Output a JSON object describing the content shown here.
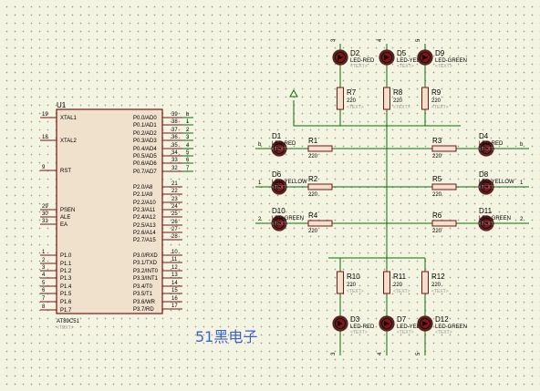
{
  "watermark": "51黑电子",
  "mcu": {
    "ref": "U1",
    "part": "AT89C51",
    "text": "<TEXT>",
    "left_pins": [
      {
        "num": "19",
        "name": "XTAL1"
      },
      {
        "num": "18",
        "name": "XTAL2"
      },
      {
        "num": "9",
        "name": "RST"
      },
      {
        "num": "29",
        "name": "PSEN"
      },
      {
        "num": "30",
        "name": "ALE"
      },
      {
        "num": "31",
        "name": "EA"
      },
      {
        "num": "1",
        "name": "P1.0"
      },
      {
        "num": "2",
        "name": "P1.1"
      },
      {
        "num": "3",
        "name": "P1.2"
      },
      {
        "num": "4",
        "name": "P1.3"
      },
      {
        "num": "5",
        "name": "P1.4"
      },
      {
        "num": "6",
        "name": "P1.5"
      },
      {
        "num": "7",
        "name": "P1.6"
      },
      {
        "num": "8",
        "name": "P1.7"
      }
    ],
    "right_pins": [
      {
        "num": "39",
        "name": "P0.0/AD0",
        "net": "b"
      },
      {
        "num": "38",
        "name": "P0.1/AD1",
        "net": "1"
      },
      {
        "num": "37",
        "name": "P0.2/AD2",
        "net": "2"
      },
      {
        "num": "36",
        "name": "P0.3/AD3",
        "net": "3"
      },
      {
        "num": "35",
        "name": "P0.4/AD4",
        "net": "4"
      },
      {
        "num": "34",
        "name": "P0.5/AD5",
        "net": "5"
      },
      {
        "num": "33",
        "name": "P0.6/AD6",
        "net": "6"
      },
      {
        "num": "32",
        "name": "P0.7/AD7",
        "net": "7"
      },
      {
        "num": "21",
        "name": "P2.0/A8",
        "net": ""
      },
      {
        "num": "22",
        "name": "P2.1/A9",
        "net": ""
      },
      {
        "num": "23",
        "name": "P2.2/A10",
        "net": ""
      },
      {
        "num": "24",
        "name": "P2.3/A11",
        "net": ""
      },
      {
        "num": "25",
        "name": "P2.4/A12",
        "net": ""
      },
      {
        "num": "26",
        "name": "P2.5/A13",
        "net": ""
      },
      {
        "num": "27",
        "name": "P2.6/A14",
        "net": ""
      },
      {
        "num": "28",
        "name": "P2.7/A15",
        "net": ""
      },
      {
        "num": "10",
        "name": "P3.0/RXD",
        "net": ""
      },
      {
        "num": "11",
        "name": "P3.1/TXD",
        "net": ""
      },
      {
        "num": "12",
        "name": "P3.2/INT0",
        "net": ""
      },
      {
        "num": "13",
        "name": "P3.3/INT1",
        "net": ""
      },
      {
        "num": "14",
        "name": "P3.4/T0",
        "net": ""
      },
      {
        "num": "15",
        "name": "P3.5/T1",
        "net": ""
      },
      {
        "num": "16",
        "name": "P3.6/WR",
        "net": ""
      },
      {
        "num": "17",
        "name": "P3.7/RD",
        "net": ""
      }
    ]
  },
  "leds": [
    {
      "id": "D1",
      "part": "LED-RED",
      "net": "b",
      "side": "left"
    },
    {
      "id": "D6",
      "part": "LED-YELLOW",
      "net": "1",
      "side": "left"
    },
    {
      "id": "D10",
      "part": "LED-GREEN",
      "net": "2",
      "side": "left"
    },
    {
      "id": "D4",
      "part": "LED-RED",
      "net": "b",
      "side": "right"
    },
    {
      "id": "D8",
      "part": "LED-YELLOW",
      "net": "1",
      "side": "right"
    },
    {
      "id": "D11",
      "part": "LED-GREEN",
      "net": "2",
      "side": "right"
    },
    {
      "id": "D2",
      "part": "LED-RED",
      "net": "3",
      "side": "top"
    },
    {
      "id": "D5",
      "part": "LED-YELLOW",
      "net": "4",
      "side": "top"
    },
    {
      "id": "D9",
      "part": "LED-GREEN",
      "net": "5",
      "side": "top"
    },
    {
      "id": "D3",
      "part": "LED-RED",
      "net": "3",
      "side": "bottom"
    },
    {
      "id": "D7",
      "part": "LED-YELLOW",
      "net": "4",
      "side": "bottom"
    },
    {
      "id": "D12",
      "part": "LED-GREEN",
      "net": "5",
      "side": "bottom"
    }
  ],
  "resistors": [
    {
      "id": "R1",
      "value": "220"
    },
    {
      "id": "R2",
      "value": "220"
    },
    {
      "id": "R4",
      "value": "220"
    },
    {
      "id": "R3",
      "value": "220"
    },
    {
      "id": "R5",
      "value": "220"
    },
    {
      "id": "R6",
      "value": "220"
    },
    {
      "id": "R7",
      "value": "220"
    },
    {
      "id": "R8",
      "value": "220"
    },
    {
      "id": "R9",
      "value": "220"
    },
    {
      "id": "R10",
      "value": "220"
    },
    {
      "id": "R11",
      "value": "220"
    },
    {
      "id": "R12",
      "value": "220"
    }
  ],
  "text_placeholder": "<TEXT>"
}
